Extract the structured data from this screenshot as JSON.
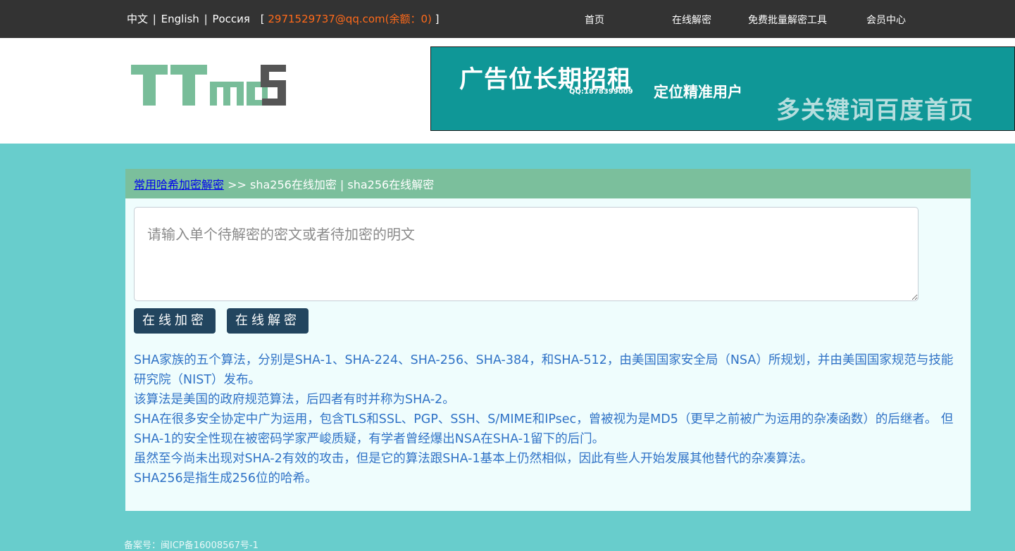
{
  "topbar": {
    "lang_zh": "中文",
    "lang_en": "English",
    "lang_ru": "Россия",
    "sep": "|",
    "account_open": "[",
    "account_email": "2971529737@qq.com(余额：0)",
    "account_close": "]",
    "nav": [
      "首页",
      "在线解密",
      "免费批量解密工具",
      "会员中心"
    ]
  },
  "header": {
    "ad": {
      "headline": "广告位长期招租",
      "qq": "QQ:1878399009",
      "subline": "定位精准用户",
      "slogan": "多关键词百度首页"
    }
  },
  "panel": {
    "breadcrumb_link": "常用哈希加密解密",
    "breadcrumb_rest": ">> sha256在线加密 | sha256在线解密",
    "input_placeholder": "请输入单个待解密的密文或者待加密的明文",
    "encrypt_button": "在线加密",
    "decrypt_button": "在线解密",
    "description": [
      "SHA家族的五个算法，分别是SHA-1、SHA-224、SHA-256、SHA-384，和SHA-512，由美国国家安全局（NSA）所规划，并由美国国家规范与技能研究院（NIST）发布。",
      "该算法是美国的政府规范算法，后四者有时并称为SHA-2。",
      "SHA在很多安全协定中广为运用，包含TLS和SSL、PGP、SSH、S/MIME和IPsec，曾被视为是MD5（更早之前被广为运用的杂凑函数）的后继者。 但SHA-1的安全性现在被密码学家严峻质疑，有学者曾经爆出NSA在SHA-1留下的后门。",
      "虽然至今尚未出现对SHA-2有效的攻击，但是它的算法跟SHA-1基本上仍然相似，因此有些人开始发展其他替代的杂凑算法。",
      "SHA256是指生成256位的哈希。"
    ]
  },
  "footer": {
    "icp": "备案号：闽ICP备16008567号-1"
  },
  "colors": {
    "topbar_bg": "#333333",
    "email": "#ff6a1a",
    "page_bg": "#68cdcc",
    "panel_head": "#7bbf9c",
    "panel_bg": "#effdfd",
    "button": "#22455f",
    "description_text": "#2f72c6",
    "ad_bg": "#0f9797",
    "logo_green": "#78bd99",
    "logo_grey": "#555555"
  }
}
